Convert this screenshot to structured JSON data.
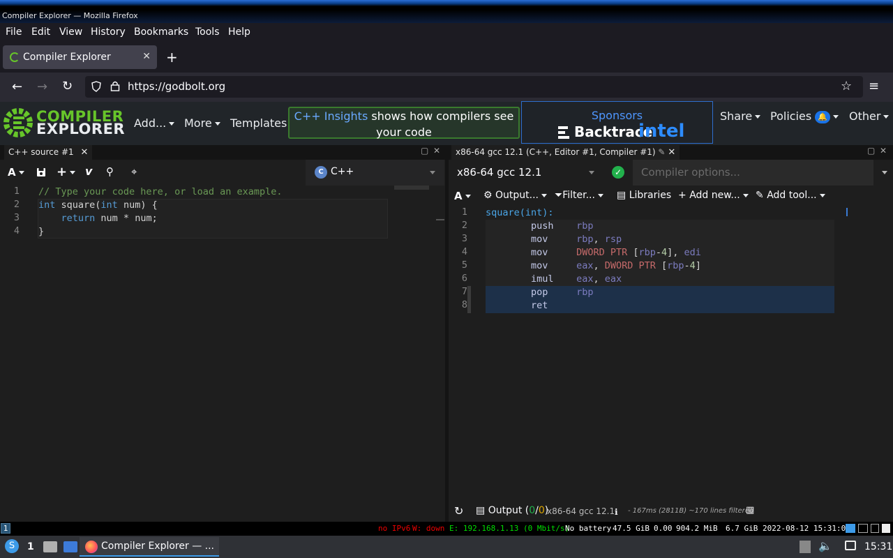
{
  "window": {
    "title": "Compiler Explorer — Mozilla Firefox"
  },
  "menu": [
    "File",
    "Edit",
    "View",
    "History",
    "Bookmarks",
    "Tools",
    "Help"
  ],
  "browser_tab": {
    "title": "Compiler Explorer"
  },
  "url": "https://godbolt.org",
  "header": {
    "logo_line1": "COMPILER",
    "logo_line2": "EXPLORER",
    "add": "Add...",
    "more": "More",
    "templates": "Templates",
    "insights_link": "C++ Insights",
    "insights_rest": " shows how compilers see",
    "insights_line2": "your code",
    "sponsors": "Sponsors",
    "sponsor1": "Backtrace",
    "sponsor2": "intel",
    "share": "Share",
    "policies": "Policies",
    "other": "Other"
  },
  "editor": {
    "tab_title": "C++ source #1",
    "language": "C++",
    "lines": [
      "1",
      "2",
      "3",
      "4"
    ]
  },
  "compiler": {
    "tab_title": "x86-64 gcc 12.1 (C++, Editor #1, Compiler #1)",
    "name": "x86-64 gcc 12.1",
    "options_placeholder": "Compiler options...",
    "toolbar": {
      "output": "Output...",
      "filter": "Filter...",
      "libraries": "Libraries",
      "add_new": "Add new...",
      "add_tool": "Add tool..."
    },
    "lines": [
      "1",
      "2",
      "3",
      "4",
      "5",
      "6",
      "7",
      "8"
    ],
    "footer": {
      "output": "Output (",
      "ok": "0",
      "slash": "/",
      "err": "0",
      "close": ")",
      "compiler": "x86-64 gcc 12.1",
      "stats": "- 167ms (2811B) ~170 lines filtered"
    }
  },
  "status": {
    "ws": "1",
    "ipv6": "no IPv6",
    "w": "W: down",
    "e": "E: 192.168.1.13 (0 Mbit/s)",
    "battery": "No battery",
    "disk": "47.5 GiB",
    "load": "0.00",
    "mem": "904.2 MiB",
    "mem2": "6.7 GiB",
    "datetime": "2022-08-12 15:31:00"
  },
  "taskbar": {
    "ws": "1",
    "app": "Compiler Explorer — ...",
    "clock": "15:31"
  }
}
